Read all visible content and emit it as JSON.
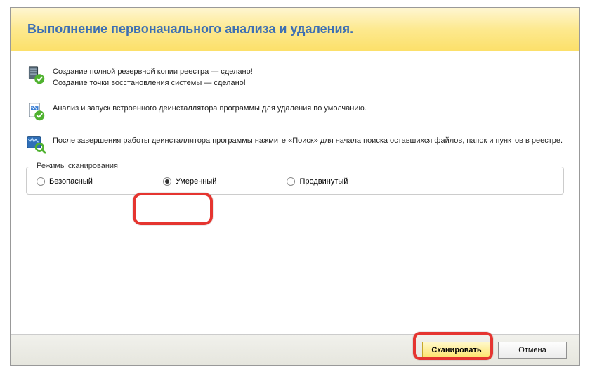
{
  "header": {
    "title": "Выполнение первоначального анализа и удаления."
  },
  "info": {
    "backup_line1": "Создание полной резервной копии реестра — сделано!",
    "backup_line2": "Создание точки восстановления системы — сделано!",
    "analysis": "Анализ и запуск встроенного деинсталлятора программы для удаления по умолчанию.",
    "after": "После завершения работы деинсталлятора программы нажмите «Поиск» для начала поиска оставшихся файлов, папок и пунктов в реестре."
  },
  "scan_modes": {
    "legend": "Режимы сканирования",
    "options": {
      "safe": "Безопасный",
      "moderate": "Умеренный",
      "advanced": "Продвинутый"
    },
    "selected": "moderate"
  },
  "footer": {
    "scan": "Сканировать",
    "cancel": "Отмена"
  }
}
